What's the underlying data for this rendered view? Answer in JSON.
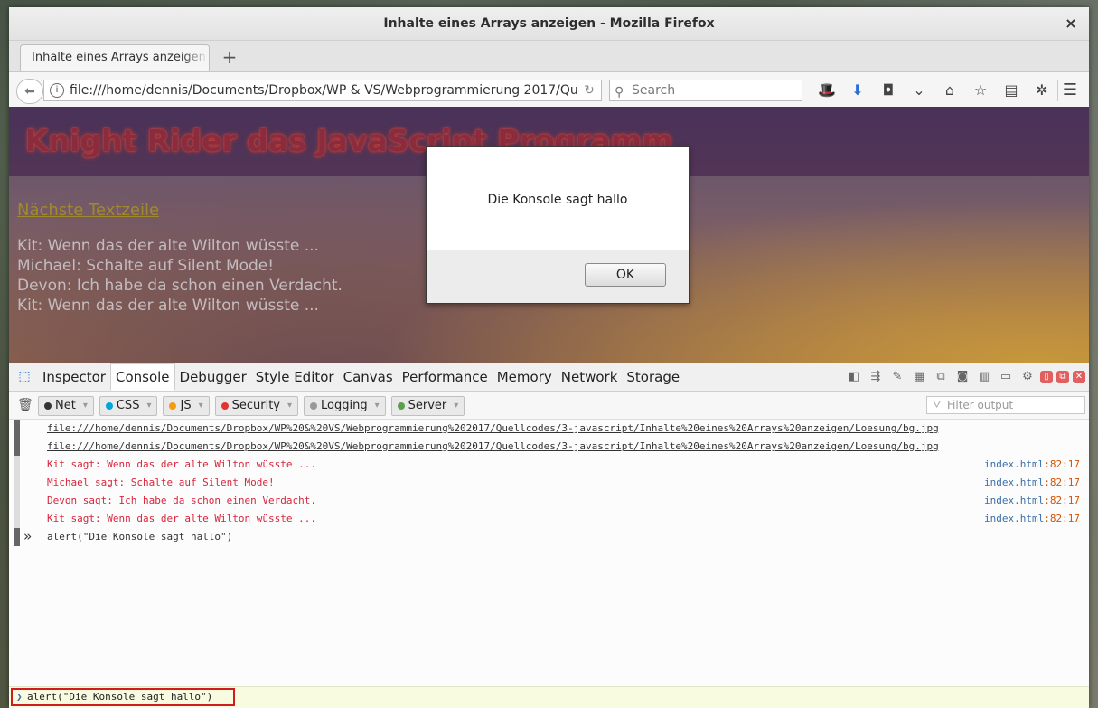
{
  "window": {
    "title": "Inhalte eines Arrays anzeigen - Mozilla Firefox",
    "close": "×"
  },
  "tab": {
    "label": "Inhalte eines Arrays anzeigen",
    "new_tab": "+"
  },
  "nav": {
    "url": "file:///home/dennis/Documents/Dropbox/WP & VS/Webprogrammierung 2017/Quellcodes",
    "search_placeholder": "Search",
    "icons": [
      "hat-icon",
      "download-icon",
      "screenshot-icon",
      "pocket-icon",
      "home-icon",
      "bookmark-star-icon",
      "reading-list-icon",
      "addon-icon"
    ],
    "icon_glyphs": [
      "🎩",
      "⬇",
      "◘",
      "⌄",
      "⌂",
      "☆",
      "▤",
      "✲"
    ]
  },
  "page": {
    "heading": "Knight Rider das JavaScript Programm",
    "link": "Nächste Textzeile",
    "lines": [
      "Kit: Wenn das der alte Wilton wüsste ...",
      "Michael: Schalte auf Silent Mode!",
      "Devon: Ich habe da schon einen Verdacht.",
      "Kit: Wenn das der alte Wilton wüsste ..."
    ]
  },
  "dialog": {
    "message": "Die Konsole sagt hallo",
    "ok": "OK"
  },
  "devtools": {
    "tabs": [
      "Inspector",
      "Console",
      "Debugger",
      "Style Editor",
      "Canvas",
      "Performance",
      "Memory",
      "Network",
      "Storage"
    ],
    "active_tab": "Console",
    "filters": [
      {
        "label": "Net",
        "color": "#333333"
      },
      {
        "label": "CSS",
        "color": "#00a6d8"
      },
      {
        "label": "JS",
        "color": "#f39c12"
      },
      {
        "label": "Security",
        "color": "#e0342e"
      },
      {
        "label": "Logging",
        "color": "#999999"
      },
      {
        "label": "Server",
        "color": "#5aa04a"
      }
    ],
    "filter_placeholder": "Filter output",
    "log": [
      {
        "type": "net",
        "text": "file:///home/dennis/Documents/Dropbox/WP%20&%20VS/Webprogrammierung%202017/Quellcodes/3-javascript/Inhalte%20eines%20Arrays%20anzeigen/Loesung/bg.jpg",
        "src": "",
        "line": ""
      },
      {
        "type": "net",
        "text": "file:///home/dennis/Documents/Dropbox/WP%20&%20VS/Webprogrammierung%202017/Quellcodes/3-javascript/Inhalte%20eines%20Arrays%20anzeigen/Loesung/bg.jpg",
        "src": "",
        "line": ""
      },
      {
        "type": "err",
        "text": "Kit sagt: Wenn das der alte Wilton wüsste ...",
        "src": "index.html",
        "line": ":82:17"
      },
      {
        "type": "err",
        "text": "Michael sagt: Schalte auf Silent Mode!",
        "src": "index.html",
        "line": ":82:17"
      },
      {
        "type": "err",
        "text": "Devon sagt: Ich habe da schon einen Verdacht.",
        "src": "index.html",
        "line": ":82:17"
      },
      {
        "type": "err",
        "text": "Kit sagt: Wenn das der alte Wilton wüsste ...",
        "src": "index.html",
        "line": ":82:17"
      },
      {
        "type": "cmd",
        "text": "alert(\"Die Konsole sagt hallo\")",
        "src": "",
        "line": ""
      }
    ],
    "prompt_glyph": "»",
    "input_value": "alert(\"Die Konsole sagt hallo\")"
  }
}
